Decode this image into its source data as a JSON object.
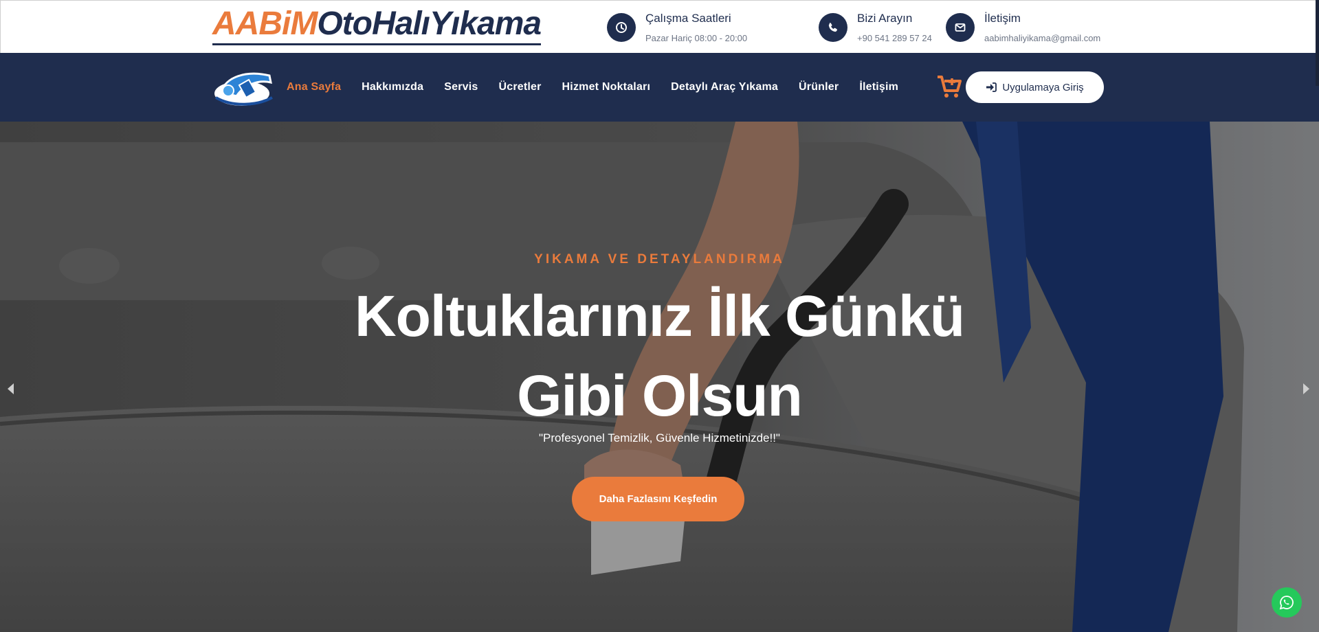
{
  "brand": {
    "part1": "AABiM",
    "part2": "OtoHalıYıkama"
  },
  "topinfo": [
    {
      "icon": "clock-icon",
      "title": "Çalışma Saatleri",
      "detail": "Pazar Hariç 08:00 - 20:00"
    },
    {
      "icon": "phone-icon",
      "title": "Bizi Arayın",
      "detail": "+90 541 289 57 24"
    },
    {
      "icon": "envelope-icon",
      "title": "İletişim",
      "detail": "aabimhaliyikama@gmail.com"
    }
  ],
  "nav": {
    "items": [
      "Ana Sayfa",
      "Hakkımızda",
      "Servis",
      "Ücretler",
      "Hizmet Noktaları",
      "Detaylı Araç Yıkama",
      "Ürünler",
      "İletişim"
    ],
    "active": "Ana Sayfa",
    "login_label": "Uygulamaya Giriş"
  },
  "hero": {
    "eyebrow": "YIKAMA VE DETAYLANDIRMA",
    "title_line1": "Koltuklarınız İlk Günkü",
    "title_line2": "Gibi Olsun",
    "quote": "\"Profesyonel Temizlik, Güvenle Hizmetinizde!!\"",
    "cta_label": "Daha Fazlasını Keşfedin"
  },
  "colors": {
    "navy": "#1f2d4e",
    "accent": "#ea7b3c",
    "whatsapp": "#25c95b"
  }
}
